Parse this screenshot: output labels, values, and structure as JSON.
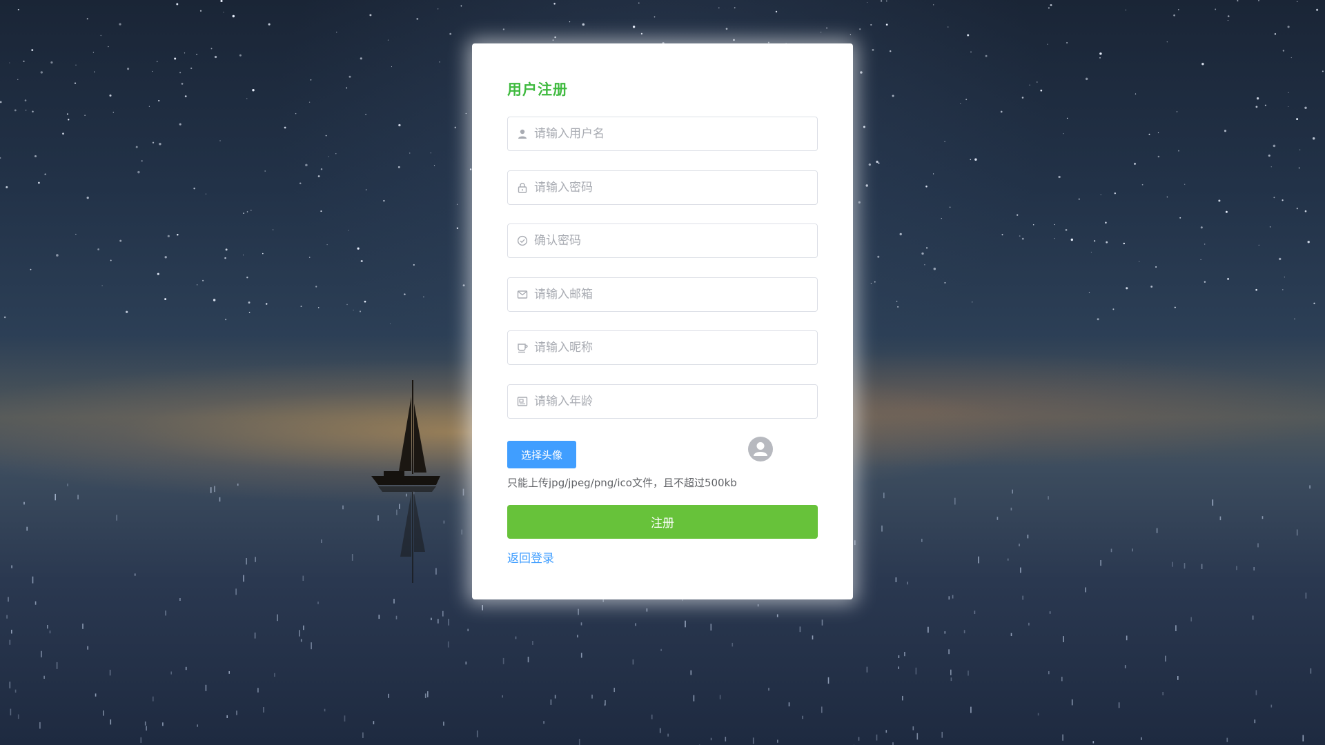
{
  "form": {
    "title": "用户注册",
    "fields": [
      {
        "name": "username",
        "placeholder": "请输入用户名",
        "icon": "user-icon"
      },
      {
        "name": "password",
        "placeholder": "请输入密码",
        "icon": "lock-icon"
      },
      {
        "name": "confirm_password",
        "placeholder": "确认密码",
        "icon": "circle-check-icon"
      },
      {
        "name": "email",
        "placeholder": "请输入邮箱",
        "icon": "message-icon"
      },
      {
        "name": "nickname",
        "placeholder": "请输入昵称",
        "icon": "coffee-cup-icon"
      },
      {
        "name": "age",
        "placeholder": "请输入年龄",
        "icon": "postcard-icon"
      }
    ],
    "upload_label": "选择头像",
    "upload_tip": "只能上传jpg/jpeg/png/ico文件，且不超过500kb",
    "avatar_icon": "avatar-icon",
    "submit_label": "注册",
    "back_label": "返回登录"
  },
  "colors": {
    "title": "#3fba3f",
    "primary": "#409eff",
    "success": "#67c23a",
    "border": "#dcdfe6",
    "placeholder": "#a8abb2"
  }
}
